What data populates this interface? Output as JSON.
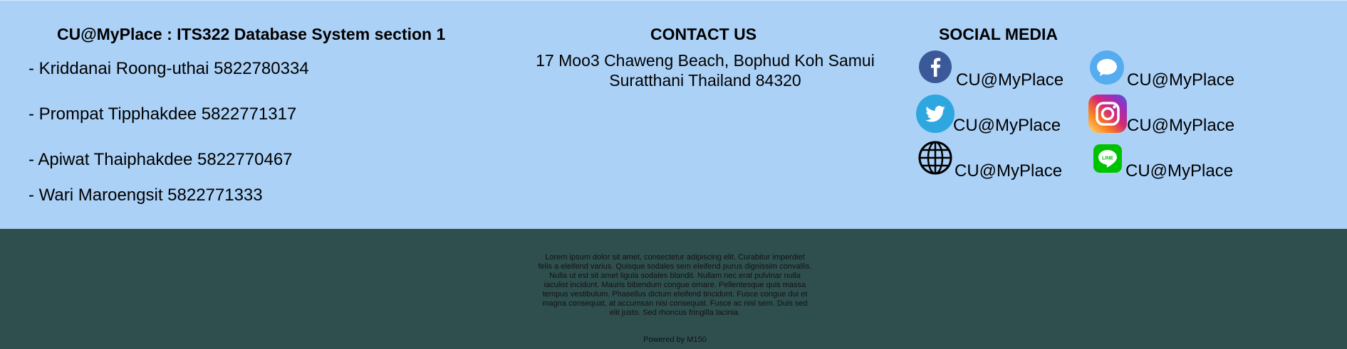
{
  "about": {
    "title": "CU@MyPlace : ITS322 Database System section 1",
    "members": [
      "- Kriddanai Roong-uthai 5822780334",
      "- Prompat Tipphakdee 5822771317",
      "- Apiwat Thaiphakdee 5822770467",
      "- Wari Maroengsit 5822771333"
    ]
  },
  "contact": {
    "title": "CONTACT US",
    "address_line1": "17 Moo3 Chaweng Beach, Bophud Koh Samui",
    "address_line2": "Suratthani Thailand 84320"
  },
  "social": {
    "title": "SOCIAL MEDIA",
    "items": [
      {
        "icon": "facebook-icon",
        "label": "CU@MyPlace"
      },
      {
        "icon": "message-icon",
        "label": "CU@MyPlace"
      },
      {
        "icon": "twitter-icon",
        "label": "CU@MyPlace"
      },
      {
        "icon": "instagram-icon",
        "label": "CU@MyPlace"
      },
      {
        "icon": "globe-icon",
        "label": "CU@MyPlace"
      },
      {
        "icon": "line-icon",
        "label": "CU@MyPlace"
      }
    ]
  },
  "footer": {
    "lorem": "Lorem ipsum dolor sit amet, consectetur adipiscing elit. Curabitur imperdiet felis a eleifend varius. Quisque sodales sem eleifend purus dignissim convallis. Nulla ut est sit amet ligula sodales blandit. Nullam nec erat pulvinar nulla iaculist incidunt. Mauris bibendum congue ornare. Pellentesque quis massa tempus vestibulum. Phasellus dictum eleifend tincidunt. Fusce congue dui et magna consequat, at accumsan nisi consequat. Fusce ac nisl sem. Duis sed elit justo. Sed rhoncus fringilla lacinia.",
    "powered": "Powered by M150"
  },
  "colors": {
    "top_bg": "#abd1f7",
    "bottom_bg": "#2f4f4f",
    "facebook": "#3b5998",
    "twitter": "#1da1f2",
    "line": "#00c300"
  }
}
